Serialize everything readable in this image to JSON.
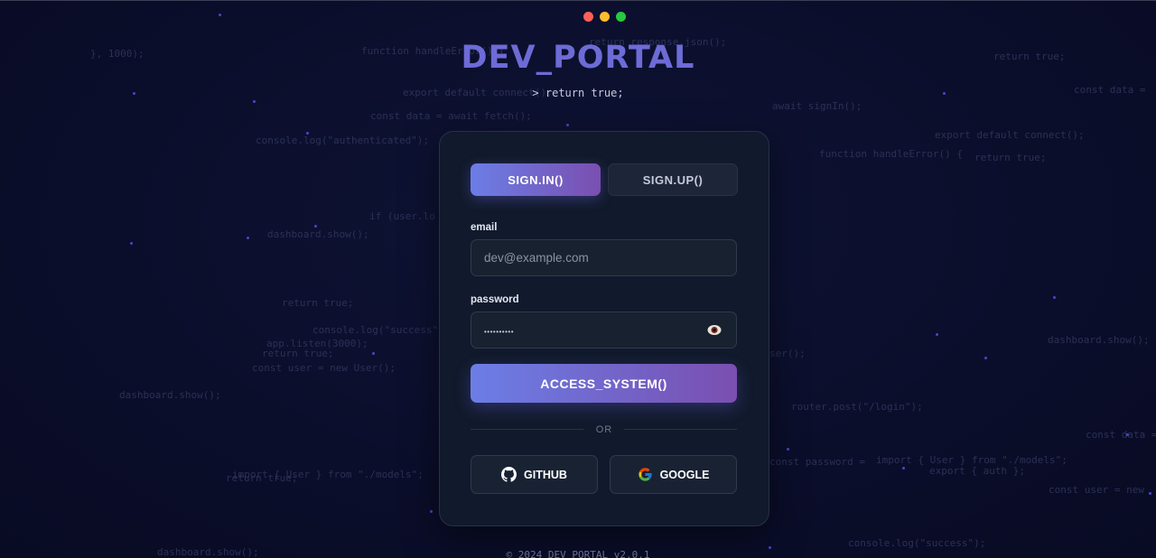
{
  "window": {
    "controls": [
      "close",
      "minimize",
      "maximize"
    ]
  },
  "brand": {
    "title": "DEV_PORTAL",
    "tagline": "> return true;"
  },
  "tabs": [
    {
      "label": "SIGN.IN()",
      "active": true
    },
    {
      "label": "SIGN.UP()",
      "active": false
    }
  ],
  "form": {
    "email": {
      "label": "email",
      "placeholder": "dev@example.com",
      "value": ""
    },
    "password": {
      "label": "password",
      "masked_value": "••••••••••"
    },
    "submit_label": "ACCESS_SYSTEM()",
    "divider_label": "OR"
  },
  "social": {
    "github_label": "GITHUB",
    "google_label": "GOOGLE"
  },
  "footer": {
    "text": "© 2024 DEV_PORTAL v2.0.1"
  },
  "background_code": [
    "}, 1000);",
    "function handleError() {",
    "return response.json();",
    "return true;",
    "const data =",
    "export default connect();",
    "await signIn();",
    "const data = await fetch();",
    "console.log(\"authenticated\");",
    "export default connect();",
    "function handleError() {",
    "return true;",
    "if (user.lo",
    "dashboard.show();",
    "return true;",
    "console.log(\"success\");",
    "app.listen(3000);",
    "return true;",
    "const user = new User();",
    "dashboard.show();",
    "dashboard.show();",
    "ser();",
    "router.post(\"/login\");",
    "const data =",
    "const password =",
    "import { User } from \"./models\";",
    "export { auth };",
    "const user = new",
    "import { User } from \"./models\";",
    "return true;",
    "dashboard.show();",
    "console.log(\"success\");"
  ],
  "colors": {
    "accent_start": "#6b7ee6",
    "accent_end": "#7a4fb0",
    "brand": "#6d6bd6",
    "background": "#0b0f2a",
    "card": "#111a2c"
  },
  "icons": {
    "password_toggle": "eye-icon",
    "github": "github-icon",
    "google": "google-icon"
  }
}
